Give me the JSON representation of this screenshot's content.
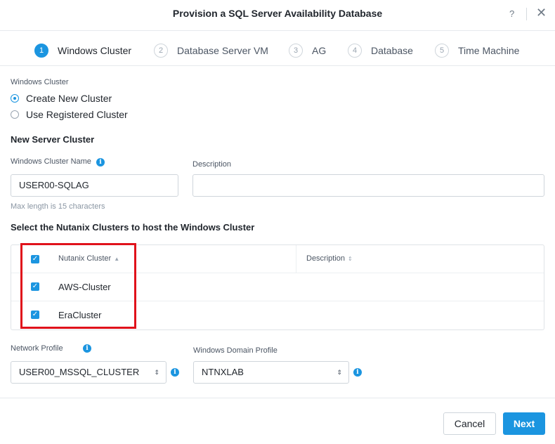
{
  "dialog": {
    "title": "Provision a SQL Server Availability Database",
    "help_label": "?",
    "close_label": "✕"
  },
  "steps": [
    {
      "num": "1",
      "label": "Windows Cluster",
      "active": true
    },
    {
      "num": "2",
      "label": "Database Server VM"
    },
    {
      "num": "3",
      "label": "AG"
    },
    {
      "num": "4",
      "label": "Database"
    },
    {
      "num": "5",
      "label": "Time Machine"
    }
  ],
  "cluster_choice": {
    "label": "Windows Cluster",
    "options": [
      "Create New Cluster",
      "Use Registered Cluster"
    ],
    "selected": "Create New Cluster"
  },
  "new_cluster": {
    "section_title": "New Server Cluster",
    "name_label": "Windows Cluster Name",
    "name_value": "USER00-SQLAG",
    "name_hint": "Max length is 15 characters",
    "description_label": "Description",
    "description_value": ""
  },
  "nutanix": {
    "section_title": "Select the Nutanix Clusters to host the Windows Cluster",
    "columns": [
      "Nutanix Cluster",
      "Description"
    ],
    "rows": [
      {
        "name": "AWS-Cluster",
        "checked": true
      },
      {
        "name": "EraCluster",
        "checked": true
      }
    ]
  },
  "profiles": {
    "network_label": "Network Profile",
    "network_value": "USER00_MSSQL_CLUSTER",
    "domain_label": "Windows Domain Profile",
    "domain_value": "NTNXLAB"
  },
  "footer": {
    "cancel_label": "Cancel",
    "next_label": "Next"
  },
  "colors": {
    "accent": "#1b95e0",
    "highlight": "#e0121b"
  }
}
